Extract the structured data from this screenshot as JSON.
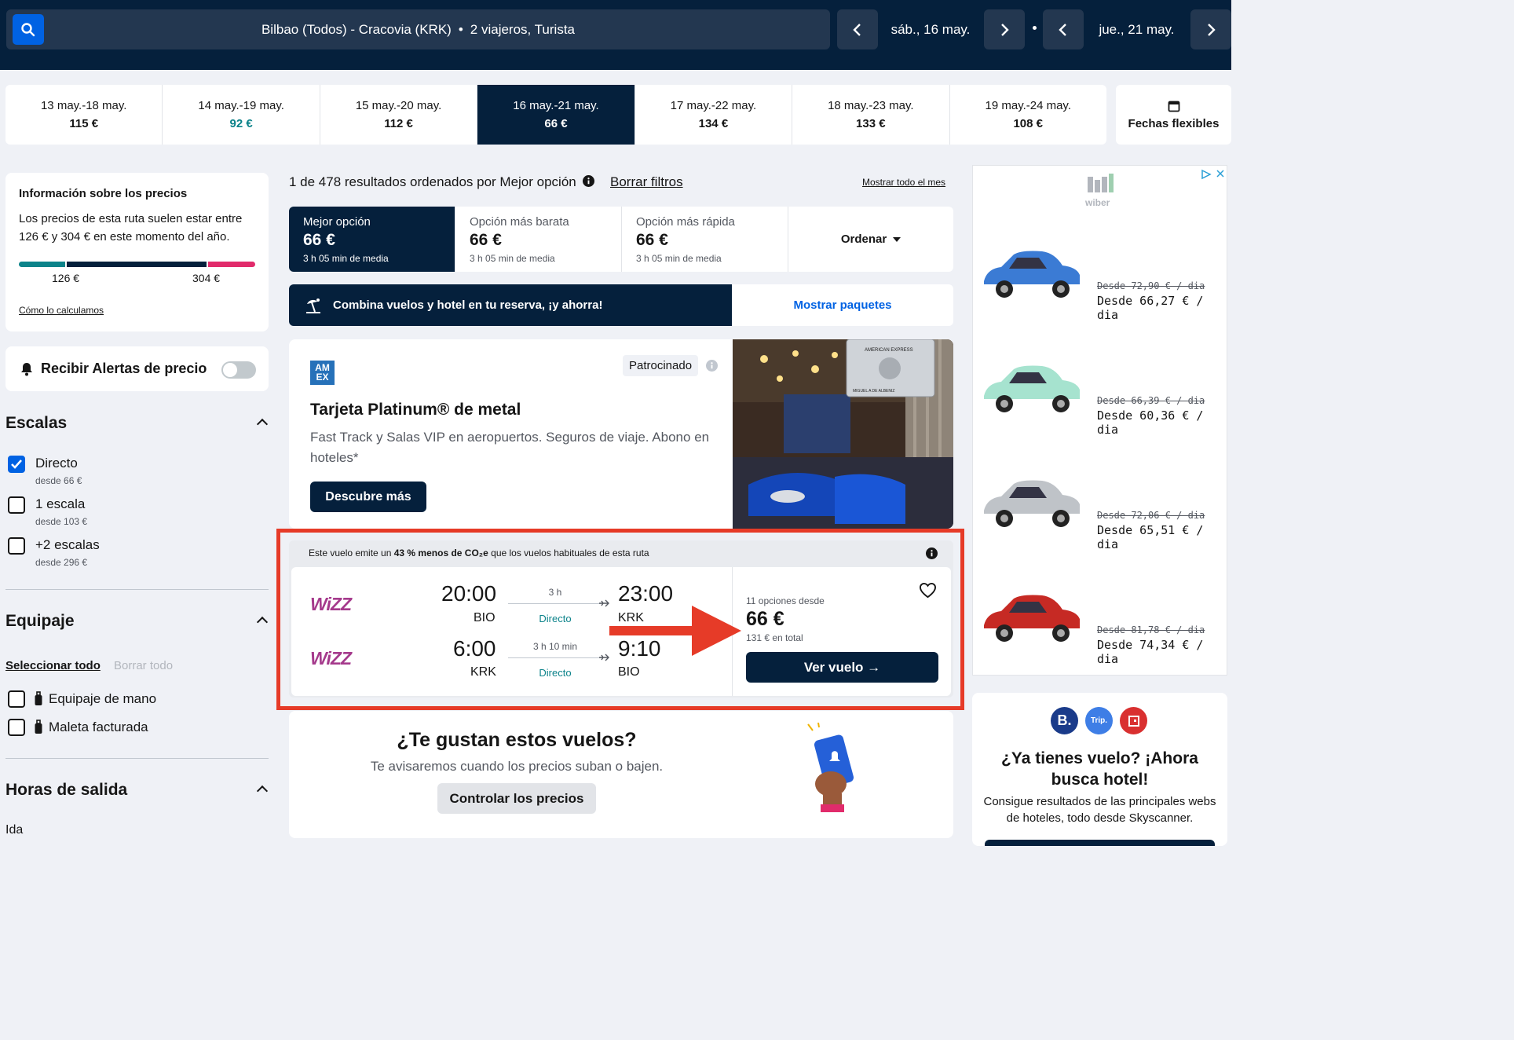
{
  "header": {
    "route": "Bilbao (Todos) - Cracovia (KRK)",
    "separator": "•",
    "travellers": "2 viajeros, Turista",
    "depart_date": "sáb., 16 may.",
    "return_date": "jue., 21 may."
  },
  "date_strip": [
    {
      "range": "13 may.-18 may.",
      "price": "115 €",
      "state": "normal"
    },
    {
      "range": "14 may.-19 may.",
      "price": "92 €",
      "state": "cheapest"
    },
    {
      "range": "15 may.-20 may.",
      "price": "112 €",
      "state": "normal"
    },
    {
      "range": "16 may.-21 may.",
      "price": "66 €",
      "state": "selected"
    },
    {
      "range": "17 may.-22 may.",
      "price": "134 €",
      "state": "normal"
    },
    {
      "range": "18 may.-23 may.",
      "price": "133 €",
      "state": "normal"
    },
    {
      "range": "19 may.-24 may.",
      "price": "108 €",
      "state": "normal"
    }
  ],
  "flexible_dates": "Fechas flexibles",
  "price_info": {
    "title": "Información sobre los precios",
    "body": "Los precios de esta ruta suelen estar entre 126 € y 304 € en este momento del año.",
    "low": "126 €",
    "high": "304 €",
    "how": "Cómo lo calculamos"
  },
  "alerts": {
    "label": "Recibir Alertas de precio",
    "enabled": false
  },
  "stops": {
    "title": "Escalas",
    "options": [
      {
        "label": "Directo",
        "sub": "desde 66 €",
        "checked": true
      },
      {
        "label": "1 escala",
        "sub": "desde 103 €",
        "checked": false
      },
      {
        "label": "+2 escalas",
        "sub": "desde 296 €",
        "checked": false
      }
    ]
  },
  "baggage": {
    "title": "Equipaje",
    "select_all": "Seleccionar todo",
    "clear_all": "Borrar todo",
    "options": [
      {
        "label": "Equipaje de mano",
        "checked": false
      },
      {
        "label": "Maleta facturada",
        "checked": false
      }
    ]
  },
  "departure_times": {
    "title": "Horas de salida",
    "outbound": "Ida"
  },
  "results": {
    "count": "1 de 478 resultados ordenados por Mejor opción",
    "clear_filters": "Borrar filtros",
    "show_month": "Mostrar todo el mes"
  },
  "sort_tabs": [
    {
      "title": "Mejor opción",
      "price": "66 €",
      "sub": "3 h 05 min de media",
      "selected": true
    },
    {
      "title": "Opción más barata",
      "price": "66 €",
      "sub": "3 h 05 min de media",
      "selected": false
    },
    {
      "title": "Opción más rápida",
      "price": "66 €",
      "sub": "3 h 05 min de media",
      "selected": false
    }
  ],
  "sort_button": "Ordenar",
  "combo": {
    "text": "Combina vuelos y hotel en tu reserva, ¡y ahorra!",
    "cta": "Mostrar paquetes"
  },
  "sponsored": {
    "logo_top": "AM",
    "logo_bottom": "EX",
    "badge": "Patrocinado",
    "title": "Tarjeta Platinum® de metal",
    "desc": "Fast Track y Salas VIP en aeropuertos. Seguros de viaje. Abono en hoteles*",
    "cta": "Descubre más",
    "card_text": "AMERICAN EXPRESS",
    "card_name": "MIGUEL A DE ALBENIZ"
  },
  "eco": {
    "prefix": "Este vuelo emite un",
    "bold": "43 % menos de CO₂e",
    "suffix": "que los vuelos habituales de esta ruta"
  },
  "flight": {
    "airline": "WiZZ",
    "outbound": {
      "dep_time": "20:00",
      "dep_apt": "BIO",
      "duration": "3 h",
      "stops": "Directo",
      "arr_time": "23:00",
      "arr_apt": "KRK"
    },
    "inbound": {
      "dep_time": "6:00",
      "dep_apt": "KRK",
      "duration": "3 h 10 min",
      "stops": "Directo",
      "arr_time": "9:10",
      "arr_apt": "BIO"
    },
    "options": "11 opciones desde",
    "price": "66 €",
    "total": "131 € en total",
    "cta": "Ver vuelo →"
  },
  "likes": {
    "title": "¿Te gustan estos vuelos?",
    "sub": "Te avisaremos cuando los precios suban o bajen.",
    "cta": "Controlar los precios"
  },
  "car_ad": {
    "brand": "wiber",
    "cars": [
      {
        "old": "Desde 72,90 € / dia",
        "new": "Desde 66,27 € / dia",
        "color": "#3b7bd4"
      },
      {
        "old": "Desde 66,39 € / dia",
        "new": "Desde 60,36 € / dia",
        "color": "#a6e3cf"
      },
      {
        "old": "Desde 72,06 € / dia",
        "new": "Desde 65,51 € / dia",
        "color": "#bfc3c8"
      },
      {
        "old": "Desde 81,78 € / dia",
        "new": "Desde 74,34 € / dia",
        "color": "#c62a24"
      }
    ]
  },
  "hotel_ad": {
    "icons": [
      "B.",
      "Trip."
    ],
    "title": "¿Ya tienes vuelo? ¡Ahora busca hotel!",
    "body": "Consigue resultados de las principales webs de hoteles, todo desde Skyscanner."
  }
}
